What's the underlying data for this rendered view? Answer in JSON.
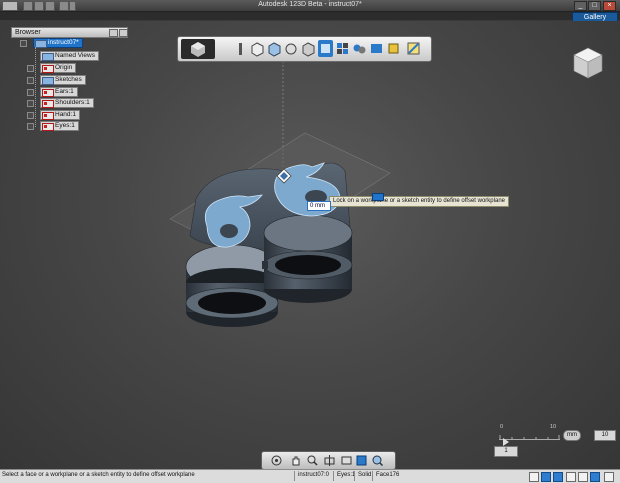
{
  "window": {
    "title": "Autodesk 123D Beta  -  instruct07*"
  },
  "gallery": {
    "label": "Gallery"
  },
  "browser": {
    "header": "Browser",
    "items": [
      {
        "label": "instruct07*",
        "icon": "document-icon",
        "root": true
      },
      {
        "label": "Named Views",
        "icon": "named-views-icon"
      },
      {
        "label": "Origin",
        "icon": "origin-icon"
      },
      {
        "label": "Sketches",
        "icon": "sketches-icon"
      },
      {
        "label": "Ears:1",
        "icon": "component-icon"
      },
      {
        "label": "Shoulders:1",
        "icon": "component-icon"
      },
      {
        "label": "Hand:1",
        "icon": "component-icon"
      },
      {
        "label": "Eyes:1",
        "icon": "component-icon"
      }
    ]
  },
  "viewport": {
    "tooltip": "Lock on a workplane or a sketch entity to define offset workplane",
    "offset_value": "0 mm"
  },
  "ruler": {
    "start": "0",
    "end": "10",
    "units": "mm",
    "scale_value": "10",
    "step_value": "1"
  },
  "statusbar": {
    "hint": "Select a face or a workplane or a sketch entity to define offset workplane",
    "document": "instruct07:0",
    "component": "Eyes:1",
    "body": "Solid",
    "face": "Face176"
  },
  "colors": {
    "accent": "#1f74c9",
    "model_body": "#3c4651",
    "sketch_plane": "#7da9ce"
  }
}
